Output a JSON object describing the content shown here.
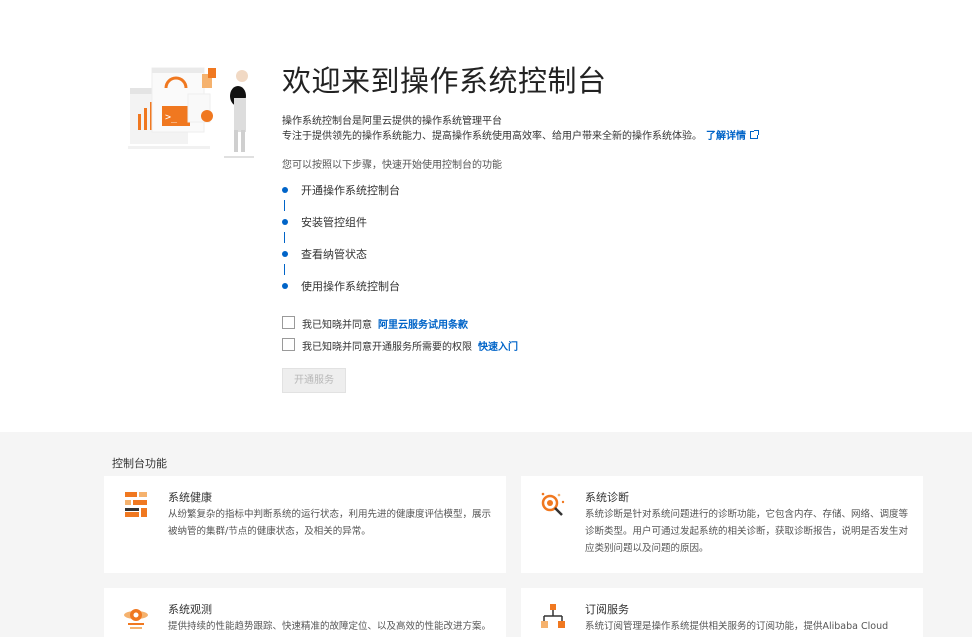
{
  "hero": {
    "title": "欢迎来到操作系统控制台",
    "desc1": "操作系统控制台是阿里云提供的操作系统管理平台",
    "desc2": "专注于提供领先的操作系统能力、提高操作系统使用高效率、给用户带来全新的操作系统体验。",
    "more_link": "了解详情",
    "steps_intro": "您可以按照以下步骤，快速开始使用控制台的功能",
    "steps": [
      {
        "label": "开通操作系统控制台"
      },
      {
        "label": "安装管控组件"
      },
      {
        "label": "查看纳管状态"
      },
      {
        "label": "使用操作系统控制台"
      }
    ],
    "agree1": {
      "text": "我已知晓并同意",
      "link": "阿里云服务试用条款"
    },
    "agree2": {
      "text": "我已知晓并同意开通服务所需要的权限",
      "link": "快速入门"
    },
    "open_button": "开通服务"
  },
  "features": {
    "title": "控制台功能",
    "cards": [
      {
        "icon": "health-icon",
        "title": "系统健康",
        "desc": "从纷繁复杂的指标中判断系统的运行状态，利用先进的健康度评估模型，展示被纳管的集群/节点的健康状态，及相关的异常。"
      },
      {
        "icon": "diagnosis-icon",
        "title": "系统诊断",
        "desc": "系统诊断是针对系统问题进行的诊断功能，它包含内存、存储、网络、调度等诊断类型。用户可通过发起系统的相关诊断，获取诊断报告，说明是否发生对应类别问题以及问题的原因。"
      },
      {
        "icon": "observe-icon",
        "title": "系统观测",
        "desc": "提供持续的性能趋势跟踪、快速精准的故障定位、以及高效的性能改进方案。"
      },
      {
        "icon": "subscription-icon",
        "title": "订阅服务",
        "desc": "系统订阅管理是操作系统提供相关服务的订阅功能，提供Alibaba Cloud"
      }
    ]
  },
  "colors": {
    "accent": "#0064c8",
    "orange": "#f07820",
    "panel_bg": "#f5f5f5"
  }
}
